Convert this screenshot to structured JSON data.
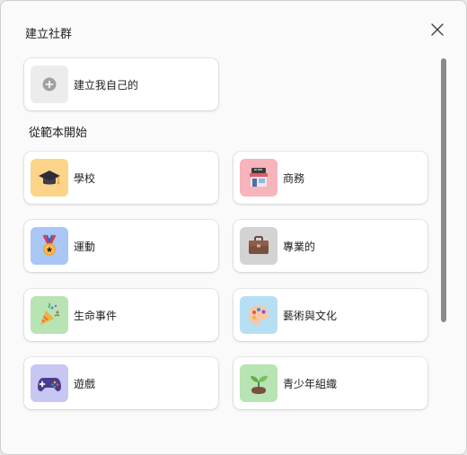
{
  "dialog": {
    "title": "建立社群",
    "create_own_label": "建立我自己的",
    "section_label": "從範本開始"
  },
  "templates": [
    {
      "label": "學校",
      "icon": "graduation-cap-icon",
      "tile_color": "#fbd48a"
    },
    {
      "label": "商務",
      "icon": "storefront-icon",
      "tile_color": "#f7b4bb"
    },
    {
      "label": "運動",
      "icon": "medal-icon",
      "tile_color": "#a9c6f5"
    },
    {
      "label": "專業的",
      "icon": "briefcase-icon",
      "tile_color": "#d3d3d3"
    },
    {
      "label": "生命事件",
      "icon": "party-popper-icon",
      "tile_color": "#b8e3b3"
    },
    {
      "label": "藝術與文化",
      "icon": "palette-icon",
      "tile_color": "#b6dff3"
    },
    {
      "label": "遊戲",
      "icon": "game-controller-icon",
      "tile_color": "#c8c7f3"
    },
    {
      "label": "青少年組織",
      "icon": "sprout-icon",
      "tile_color": "#b8e3b3"
    }
  ],
  "colors": {
    "background": "#fafafa",
    "card": "#ffffff",
    "scrollbar_thumb": "#8a8a8a"
  }
}
